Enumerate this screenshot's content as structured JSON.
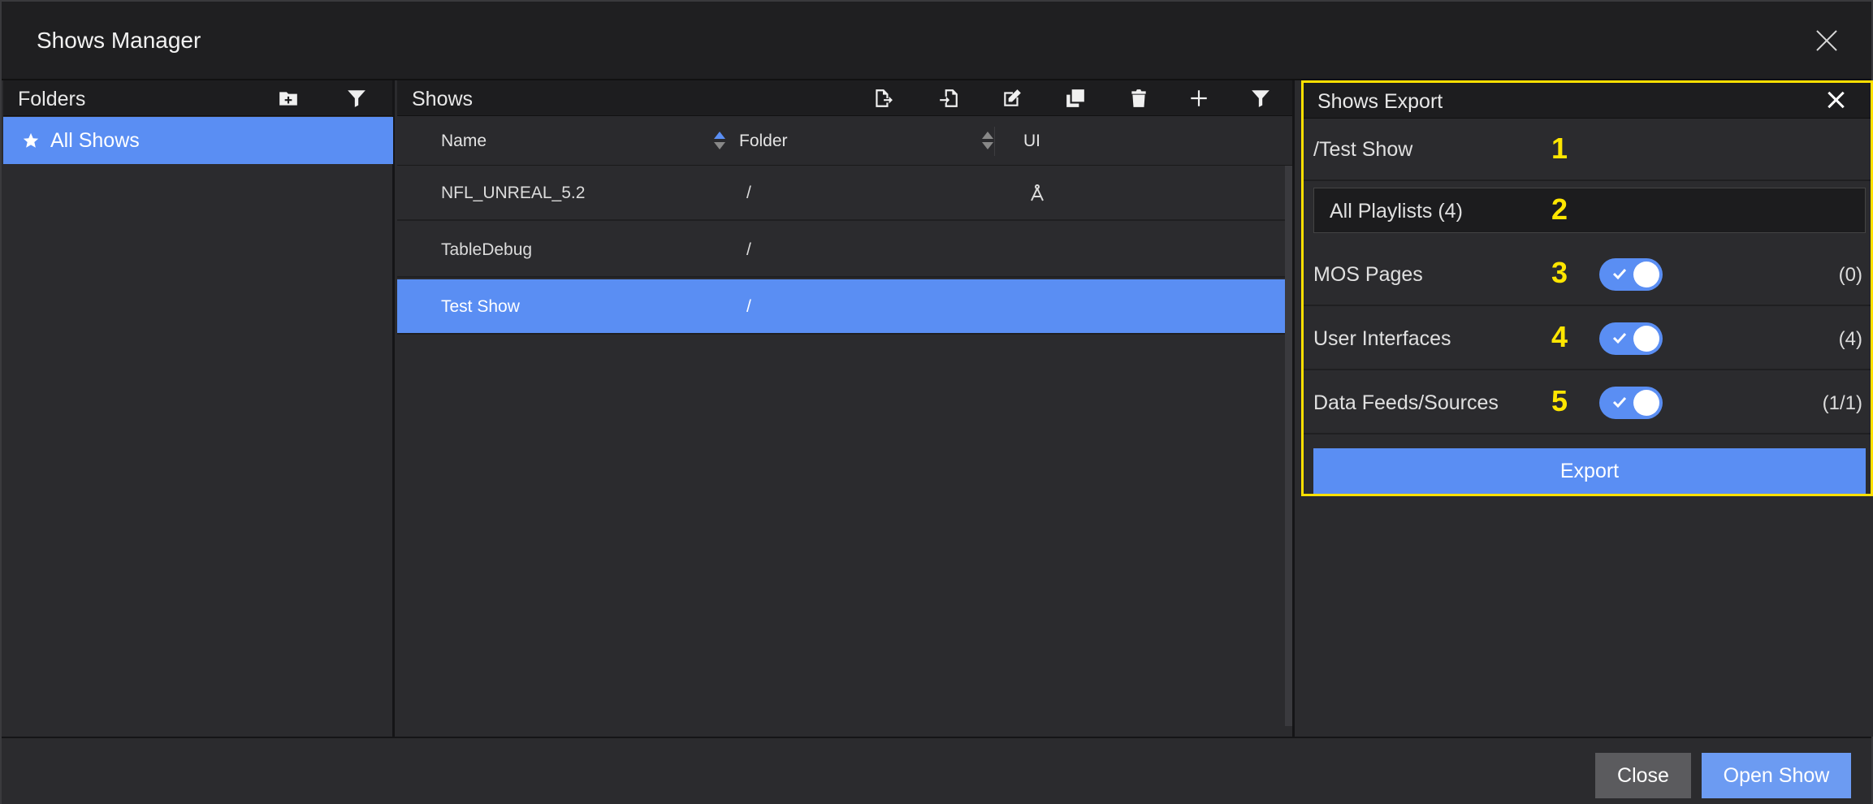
{
  "window": {
    "title": "Shows Manager"
  },
  "folders": {
    "header": "Folders",
    "items": [
      {
        "label": "All Shows",
        "icon": "star-icon"
      }
    ]
  },
  "shows": {
    "header": "Shows",
    "columns": {
      "name": "Name",
      "folder": "Folder",
      "ui": "UI"
    },
    "rows": [
      {
        "name": "NFL_UNREAL_5.2",
        "folder": "/",
        "ui_icon": "compass-icon"
      },
      {
        "name": "TableDebug",
        "folder": "/",
        "ui_icon": ""
      },
      {
        "name": "Test Show",
        "folder": "/",
        "ui_icon": ""
      }
    ]
  },
  "export": {
    "header": "Shows Export",
    "show_path": "/Test Show",
    "playlists_label": "All Playlists (4)",
    "options": [
      {
        "label": "MOS Pages",
        "count": "(0)",
        "enabled": true
      },
      {
        "label": "User Interfaces",
        "count": "(4)",
        "enabled": true
      },
      {
        "label": "Data Feeds/Sources",
        "count": "(1/1)",
        "enabled": true
      }
    ],
    "markers": [
      "1",
      "2",
      "3",
      "4",
      "5"
    ],
    "export_label": "Export"
  },
  "footer": {
    "close_label": "Close",
    "open_label": "Open Show"
  },
  "colors": {
    "accent": "#5a8ef3",
    "highlight": "#ffe000",
    "background": "#2b2b2e"
  }
}
